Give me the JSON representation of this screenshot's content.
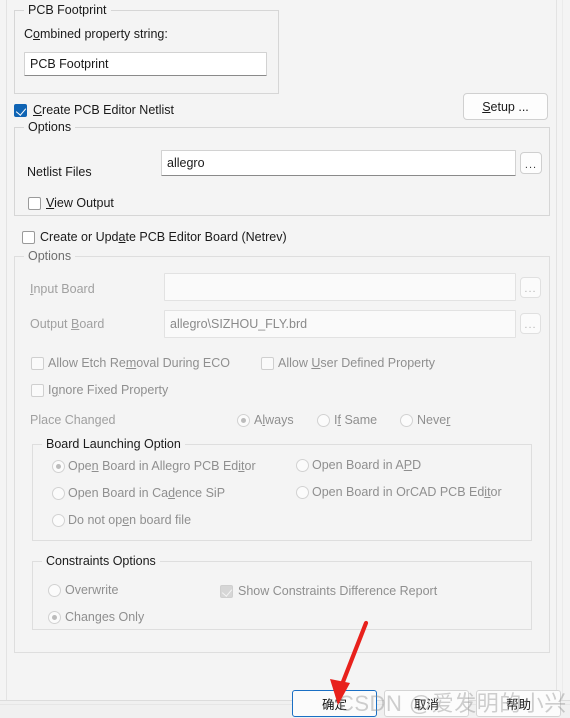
{
  "dialog": {
    "footprint_group": {
      "legend": "PCB Footprint",
      "combined_label": "Combined property string:",
      "combined_value": "PCB Footprint"
    },
    "netlist": {
      "checkbox_label": "Create PCB Editor Netlist",
      "checkbox_checked": true,
      "setup_button": "Setup ...",
      "options_legend": "Options",
      "netlist_files_label": "Netlist Files",
      "netlist_files_value": "allegro",
      "netlist_files_browse": "...",
      "view_output_label": "View Output",
      "view_output_checked": false
    },
    "netrev": {
      "checkbox_label": "Create or Update PCB Editor Board (Netrev)",
      "checkbox_checked": false,
      "options_legend": "Options",
      "input_board_label": "Input Board",
      "input_board_value": "",
      "input_board_browse": "...",
      "output_board_label": "Output Board",
      "output_board_value": "allegro\\SIZHOU_FLY.brd",
      "output_board_browse": "...",
      "allow_etch_removal_label": "Allow Etch Removal During ECO",
      "allow_etch_removal_checked": false,
      "allow_user_defined_label": "Allow User Defined Property",
      "allow_user_defined_checked": false,
      "ignore_fixed_label": "Ignore Fixed Property",
      "ignore_fixed_checked": false,
      "place_changed_label": "Place Changed",
      "place_changed_options": [
        {
          "label": "Always",
          "selected": true
        },
        {
          "label": "If Same",
          "selected": false
        },
        {
          "label": "Never",
          "selected": false
        }
      ],
      "board_launching": {
        "legend": "Board Launching Option",
        "options": [
          {
            "label": "Open Board in Allegro PCB Editor",
            "selected": true
          },
          {
            "label": "Open Board in APD",
            "selected": false
          },
          {
            "label": "Open Board in Cadence SiP",
            "selected": false
          },
          {
            "label": "Open Board in OrCAD PCB Editor",
            "selected": false
          },
          {
            "label": "Do not open board file",
            "selected": false
          }
        ]
      },
      "constraints": {
        "legend": "Constraints Options",
        "options": [
          {
            "label": "Overwrite",
            "selected": false
          },
          {
            "label": "Changes  Only",
            "selected": true
          }
        ],
        "show_report_label": "Show Constraints Difference Report",
        "show_report_checked": true
      }
    },
    "footer": {
      "ok": "确定",
      "cancel": "取消",
      "help": "帮助"
    },
    "watermark": "CSDN @爱发明的小兴",
    "annotation_arrow_color": "#e8211c",
    "accent_color": "#0f64b4"
  }
}
